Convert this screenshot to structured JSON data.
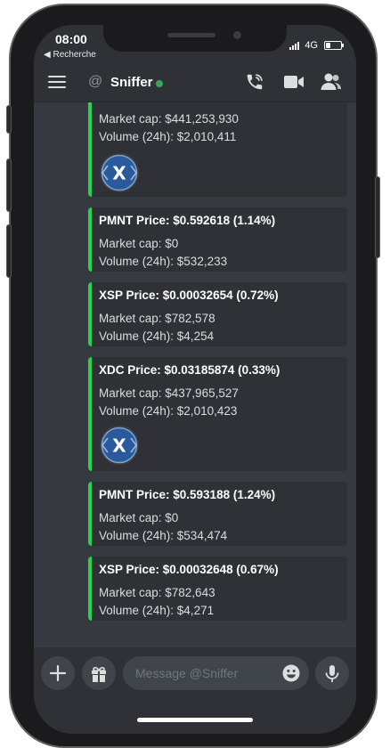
{
  "status_bar": {
    "time": "08:00",
    "back_label": "◀ Recherche",
    "network": "4G"
  },
  "header": {
    "channel_name": "Sniffer",
    "online": true
  },
  "embeds": [
    {
      "title": "",
      "market_cap": "Market cap: $441,253,930",
      "volume": "Volume (24h): $2,010,411",
      "has_logo": true,
      "logo_letter": "X"
    },
    {
      "title": "PMNT Price: $0.592618 (1.14%)",
      "market_cap": "Market cap: $0",
      "volume": "Volume (24h): $532,233"
    },
    {
      "title": "XSP Price: $0.00032654 (0.72%)",
      "market_cap": "Market cap: $782,578",
      "volume": "Volume (24h): $4,254"
    },
    {
      "title": "XDC Price: $0.03185874 (0.33%)",
      "market_cap": "Market cap: $437,965,527",
      "volume": "Volume (24h): $2,010,423",
      "has_logo": true,
      "logo_letter": "X"
    },
    {
      "title": "PMNT Price: $0.593188 (1.24%)",
      "market_cap": "Market cap: $0",
      "volume": "Volume (24h): $534,474"
    },
    {
      "title": "XSP Price: $0.00032648 (0.67%)",
      "market_cap": "Market cap: $782,643",
      "volume": "Volume (24h): $4,271"
    }
  ],
  "composer": {
    "placeholder": "Message @Sniffer"
  },
  "colors": {
    "background": "#36393f",
    "embed_background": "#2f3136",
    "embed_accent": "#2bd24e",
    "online": "#3ba55d",
    "logo_blue": "#2a5a9b"
  }
}
